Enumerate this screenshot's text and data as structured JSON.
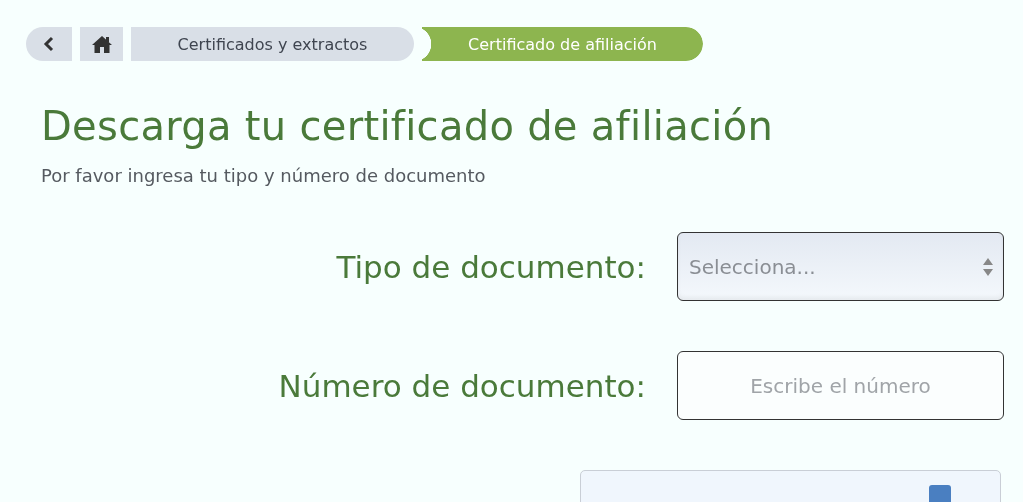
{
  "breadcrumb": [
    {
      "label": "Certificados y extractos",
      "selected": false
    },
    {
      "label": "Certificado de afiliación",
      "selected": true
    }
  ],
  "title": "Descarga tu certificado de afiliación",
  "subtitle": "Por favor ingresa tu tipo y número de documento",
  "form": [
    {
      "kind": "select",
      "label": "Tipo de documento:",
      "placeholder": "Selecciona..."
    },
    {
      "kind": "text",
      "label": "Número de documento:",
      "placeholder": "Escribe el número"
    }
  ]
}
